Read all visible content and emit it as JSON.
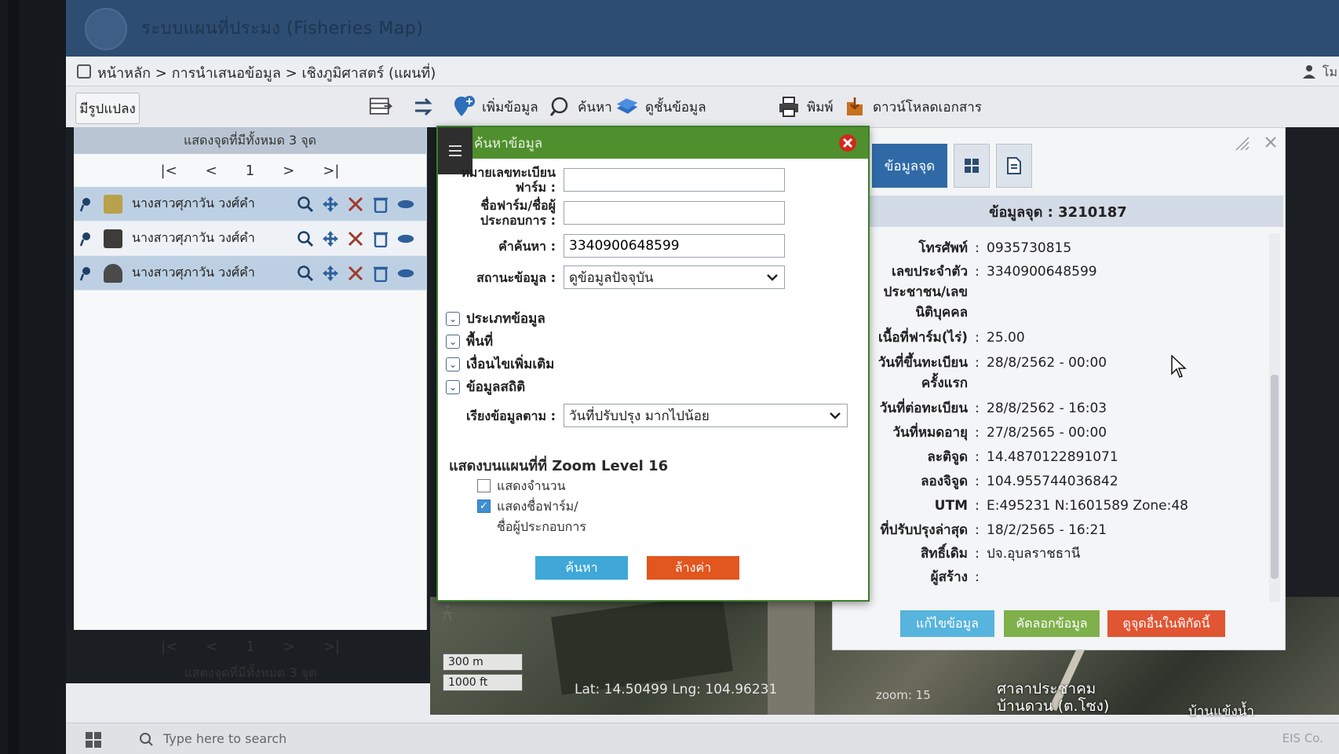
{
  "app": {
    "title": "ระบบแผนที่ประมง (Fisheries Map)",
    "breadcrumb": "หน้าหลัก > การนำเสนอข้อมูล > เชิงภูมิศาสตร์ (แผนที่)",
    "user_label": "โม"
  },
  "toolbar": {
    "layer_button": "มีรูปแปลง",
    "add_data": "เพิ่มข้อมูล",
    "search": "ค้นหา",
    "view_layers": "ดูชั้นข้อมูล",
    "print": "พิมพ์",
    "download": "ดาวน์โหลดเอกสาร"
  },
  "list_panel": {
    "header": "แสดงจุดที่มีทั้งหมด 3 จุด",
    "footer": "แสดงจุดที่มีทั้งหมด 3 จุด",
    "pager": {
      "first": "|<",
      "prev": "<",
      "page": "1",
      "next": ">",
      "last": ">|"
    },
    "rows": [
      {
        "name": "นางสาวศุภาวัน วงศ์คำ"
      },
      {
        "name": "นางสาวศุภาวัน วงศ์คำ"
      },
      {
        "name": "นางสาวศุภาวัน วงศ์คำ"
      }
    ]
  },
  "dialog": {
    "title": "ค้นหาข้อมูล",
    "fields": {
      "farm_reg_label": "หมายเลขทะเบียนฟาร์ม :",
      "farm_reg_value": "",
      "farm_name_label": "ชื่อฟาร์ม/ชื่อผู้ประกอบการ :",
      "farm_name_value": "",
      "keyword_label": "คำค้นหา :",
      "keyword_value": "3340900648599",
      "status_label": "สถานะข้อมูล :",
      "status_value": "ดูข้อมูลปัจจุบัน"
    },
    "sections": [
      "ประเภทข้อมูล",
      "พื้นที่",
      "เงื่อนไขเพิ่มเติม",
      "ข้อมูลสถิติ"
    ],
    "sort_label": "เรียงข้อมูลตาม :",
    "sort_value": "วันที่ปรับปรุง มากไปน้อย",
    "zoom_title": "แสดงบนแผนที่ที่ Zoom Level 16",
    "opt_count": "แสดงจำนวน",
    "opt_farm_name_1": "แสดงชื่อฟาร์ม/",
    "opt_farm_name_2": "ชื่อผู้ประกอบการ",
    "search_button": "ค้นหา",
    "clear_button": "ล้างค่า"
  },
  "info": {
    "tab_point": "ข้อมูลจุด",
    "header": "ข้อมูลจุด : 3210187",
    "rows": [
      {
        "k": "โทรศัพท์",
        "v": "0935730815"
      },
      {
        "k": "เลขประจำตัว",
        "v": "3340900648599"
      },
      {
        "k": "ประชาชน/เลข",
        "v": ""
      },
      {
        "k": "นิติบุคคล",
        "v": ""
      },
      {
        "k": "เนื้อที่ฟาร์ม(ไร่)",
        "v": "25.00"
      },
      {
        "k": "วันที่ขึ้นทะเบียน",
        "v": "28/8/2562 - 00:00"
      },
      {
        "k": "ครั้งแรก",
        "v": ""
      },
      {
        "k": "วันที่ต่อทะเบียน",
        "v": "28/8/2562 - 16:03"
      },
      {
        "k": "วันที่หมดอายุ",
        "v": "27/8/2565 - 00:00"
      },
      {
        "k": "ละติจูด",
        "v": "14.4870122891071"
      },
      {
        "k": "ลองจิจูด",
        "v": "104.955744036842"
      },
      {
        "k": "UTM",
        "v": "E:495231 N:1601589 Zone:48"
      },
      {
        "k": "ที่ปรับปรุงล่าสุด",
        "v": "18/2/2565 - 16:21"
      },
      {
        "k": "สิทธิ์เดิม",
        "v": "ปจ.อุบลราชธานี"
      },
      {
        "k": "ผู้สร้าง",
        "v": ""
      }
    ],
    "edit_button": "แก้ไขข้อมูล",
    "copy_button": "คัดลอกข้อมูล",
    "near_button": "ดูจุดอื่นในพิกัดนี้"
  },
  "map": {
    "scale_m": "300 m",
    "scale_ft": "1000 ft",
    "coords": "Lat: 14.50499   Lng: 104.96231",
    "zoom_label": "zoom: 15",
    "poi_1": "ศาลาประชาคม",
    "poi_2": "บ้านดวน (ต.โซง)",
    "poi_3": "บ้านแข้งน้ำ"
  },
  "taskbar": {
    "search_placeholder": "Type here to search",
    "brand": "EIS Co."
  }
}
